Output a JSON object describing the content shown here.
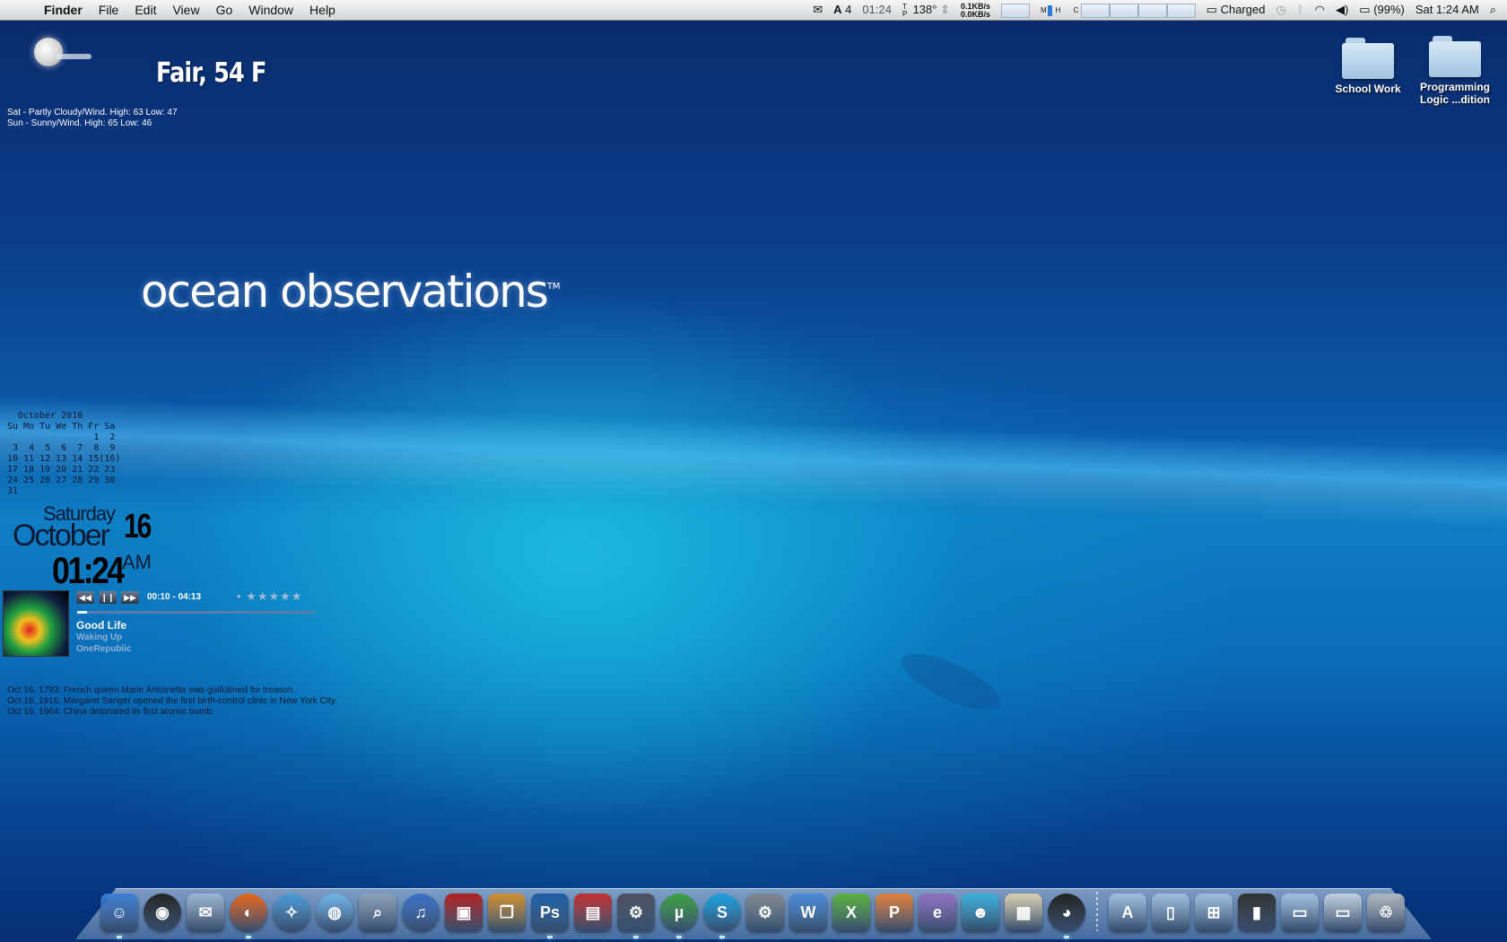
{
  "menubar": {
    "app_name": "Finder",
    "menus": [
      "File",
      "Edit",
      "View",
      "Go",
      "Window",
      "Help"
    ],
    "status": {
      "badge_count": "4",
      "clock_small": "01:24",
      "temp": "138°",
      "net_up": "0.1KB/s",
      "net_down": "0.0KB/s",
      "battery_text": "Charged",
      "battery_percent": "(99%)",
      "datetime": "Sat 1:24 AM"
    }
  },
  "weather": {
    "current": "Fair, 54 F",
    "forecast": [
      "Sat - Partly Cloudy/Wind. High: 63 Low: 47",
      "Sun - Sunny/Wind. High: 65 Low: 46"
    ]
  },
  "desktop_icons": [
    {
      "label": "School Work"
    },
    {
      "label": "Programming Logic ...dition"
    }
  ],
  "wallpaper": {
    "logo_text": "ocean observations",
    "logo_mark": "TM"
  },
  "calendar": {
    "title": "October 2010",
    "header": "Su Mo Tu We Th Fr Sa",
    "rows": [
      "                1  2",
      " 3  4  5  6  7  8  9",
      "10 11 12 13 14 15(16)",
      "17 18 19 20 21 22 23",
      "24 25 26 27 28 29 30",
      "31"
    ]
  },
  "clock": {
    "day_name": "Saturday",
    "month_name": "October",
    "day_num": "16",
    "time": "01:24",
    "ampm": "AM"
  },
  "music": {
    "position": "00:10 - 04:13",
    "progress": 0.04,
    "rating_dot": "•",
    "stars": "★★★★★",
    "song": "Good Life",
    "album": "Waking Up",
    "artist": "OneRepublic"
  },
  "history": [
    "Oct 16, 1793: French queen Marie Antoinette was guillotined for treason.",
    "Oct 16, 1916: Margaret Sanger opened the first birth-control clinic in New York City.",
    "Oct 16, 1964: China detonated its first atomic bomb."
  ],
  "dock": {
    "apps": [
      {
        "name": "finder-icon",
        "glyph": "☺",
        "color": "#3d7fd6"
      },
      {
        "name": "dashboard-icon",
        "glyph": "◉",
        "color": "#222"
      },
      {
        "name": "mail-icon",
        "glyph": "✉",
        "color": "#9ab3d2"
      },
      {
        "name": "firefox-icon",
        "glyph": "◐",
        "color": "#e8651c"
      },
      {
        "name": "safari-icon",
        "glyph": "✧",
        "color": "#4a9ad8"
      },
      {
        "name": "ichat-icon",
        "glyph": "◍",
        "color": "#6fb3ea"
      },
      {
        "name": "preview-icon",
        "glyph": "⌕",
        "color": "#8aa0b8"
      },
      {
        "name": "itunes-icon",
        "glyph": "♫",
        "color": "#3a70c8"
      },
      {
        "name": "dvd-player-icon",
        "glyph": "▣",
        "color": "#b02020"
      },
      {
        "name": "iphoto-icon",
        "glyph": "❐",
        "color": "#d09030"
      },
      {
        "name": "photoshop-icon",
        "glyph": "Ps",
        "color": "#1e5fa8"
      },
      {
        "name": "photo-booth-icon",
        "glyph": "▤",
        "color": "#c03030"
      },
      {
        "name": "steam-icon",
        "glyph": "⚙",
        "color": "#4a5060"
      },
      {
        "name": "utorrent-icon",
        "glyph": "µ",
        "color": "#3aa040"
      },
      {
        "name": "skype-icon",
        "glyph": "S",
        "color": "#1aa0e0"
      },
      {
        "name": "system-preferences-icon",
        "glyph": "⚙",
        "color": "#808890"
      },
      {
        "name": "word-icon",
        "glyph": "W",
        "color": "#4a8ad8"
      },
      {
        "name": "excel-icon",
        "glyph": "X",
        "color": "#5ab040"
      },
      {
        "name": "powerpoint-icon",
        "glyph": "P",
        "color": "#e0803a"
      },
      {
        "name": "entourage-icon",
        "glyph": "e",
        "color": "#9070c0"
      },
      {
        "name": "messenger-icon",
        "glyph": "☻",
        "color": "#3ab0d8"
      },
      {
        "name": "mac-theme-icon",
        "glyph": "▦",
        "color": "#d8d0b0"
      },
      {
        "name": "camino-icon",
        "glyph": "◕",
        "color": "#202020"
      }
    ],
    "stacks": [
      {
        "name": "applications-stack-icon",
        "glyph": "A",
        "color": "#9cc0e0"
      },
      {
        "name": "documents-stack-icon",
        "glyph": "▯",
        "color": "#9cc0e0"
      },
      {
        "name": "downloads-stack-icon",
        "glyph": "⊞",
        "color": "#9cc0e0"
      },
      {
        "name": "server-icon",
        "glyph": "▮",
        "color": "#303030"
      },
      {
        "name": "screenshot-stack-icon",
        "glyph": "▭",
        "color": "#a0c0e0"
      },
      {
        "name": "browser-stack-icon",
        "glyph": "▭",
        "color": "#c0d0e0"
      },
      {
        "name": "trash-icon",
        "glyph": "♲",
        "color": "#b0b8c0"
      }
    ]
  }
}
